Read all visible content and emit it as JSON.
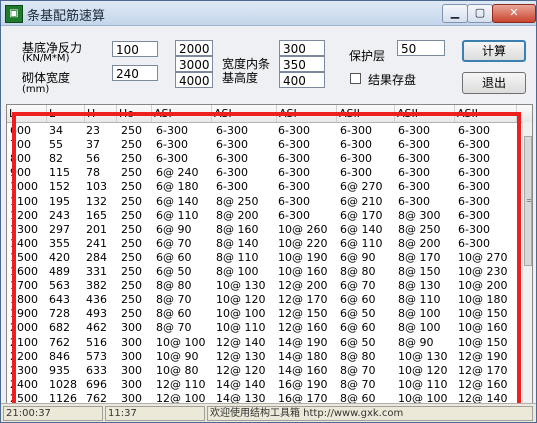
{
  "window": {
    "title": "条基配筋速算",
    "minimize": "0",
    "restore": "1",
    "close": "r"
  },
  "form": {
    "pressure_label": "基底净反力",
    "pressure_unit": "(KN/M*M)",
    "pressure_value": "100",
    "wall_width_label": "砌体宽度",
    "wall_width_unit": "(mm)",
    "wall_width_value": "240",
    "width_values": [
      "2000",
      "3000",
      "4000"
    ],
    "height_label_line1": "宽度内条",
    "height_label_line2": "基高度",
    "height_values": [
      "300",
      "350",
      "400"
    ],
    "cover_label": "保护层",
    "cover_value": "50",
    "save_label": "结果存盘",
    "save_checked": false,
    "calc_button": "计算",
    "exit_button": "退出"
  },
  "table": {
    "columns": [
      "L",
      "L",
      "H",
      "Ho",
      "ASI",
      "ASI",
      "ASI",
      "ASII",
      "ASII",
      "ASII"
    ],
    "rows": [
      [
        "600",
        "34",
        "23",
        "250",
        "6-300",
        "6-300",
        "6-300",
        "6-300",
        "6-300",
        "6-300"
      ],
      [
        "700",
        "55",
        "37",
        "250",
        "6-300",
        "6-300",
        "6-300",
        "6-300",
        "6-300",
        "6-300"
      ],
      [
        "800",
        "82",
        "56",
        "250",
        "6-300",
        "6-300",
        "6-300",
        "6-300",
        "6-300",
        "6-300"
      ],
      [
        "900",
        "115",
        "78",
        "250",
        "6@ 240",
        "6-300",
        "6-300",
        "6-300",
        "6-300",
        "6-300"
      ],
      [
        "1000",
        "152",
        "103",
        "250",
        "6@ 180",
        "6-300",
        "6-300",
        "6@ 270",
        "6-300",
        "6-300"
      ],
      [
        "1100",
        "195",
        "132",
        "250",
        "6@ 140",
        "8@ 250",
        "6-300",
        "6@ 210",
        "6-300",
        "6-300"
      ],
      [
        "1200",
        "243",
        "165",
        "250",
        "6@ 110",
        "8@ 200",
        "6-300",
        "6@ 170",
        "8@ 300",
        "6-300"
      ],
      [
        "1300",
        "297",
        "201",
        "250",
        "6@ 90",
        "8@ 160",
        "10@ 260",
        "6@ 140",
        "8@ 250",
        "6-300"
      ],
      [
        "1400",
        "355",
        "241",
        "250",
        "6@ 70",
        "8@ 140",
        "10@ 220",
        "6@ 110",
        "8@ 200",
        "6-300"
      ],
      [
        "1500",
        "420",
        "284",
        "250",
        "6@ 60",
        "8@ 110",
        "10@ 190",
        "6@ 90",
        "8@ 170",
        "10@ 270"
      ],
      [
        "1600",
        "489",
        "331",
        "250",
        "6@ 50",
        "8@ 100",
        "10@ 160",
        "8@ 80",
        "8@ 150",
        "10@ 230"
      ],
      [
        "1700",
        "563",
        "382",
        "250",
        "8@ 80",
        "10@ 130",
        "12@ 200",
        "6@ 70",
        "8@ 130",
        "10@ 200"
      ],
      [
        "1800",
        "643",
        "436",
        "250",
        "8@ 70",
        "10@ 120",
        "12@ 170",
        "6@ 60",
        "8@ 110",
        "10@ 180"
      ],
      [
        "1900",
        "728",
        "493",
        "250",
        "8@ 60",
        "10@ 100",
        "12@ 150",
        "6@ 50",
        "8@ 100",
        "10@ 150"
      ],
      [
        "2000",
        "682",
        "462",
        "300",
        "8@ 70",
        "10@ 110",
        "12@ 160",
        "6@ 60",
        "8@ 100",
        "10@ 160"
      ],
      [
        "2100",
        "762",
        "516",
        "300",
        "10@ 100",
        "12@ 140",
        "14@ 190",
        "6@ 50",
        "8@ 90",
        "10@ 150"
      ],
      [
        "2200",
        "846",
        "573",
        "300",
        "10@ 90",
        "12@ 130",
        "14@ 180",
        "8@ 80",
        "10@ 130",
        "12@ 190"
      ],
      [
        "2300",
        "935",
        "633",
        "300",
        "10@ 80",
        "12@ 120",
        "14@ 160",
        "8@ 70",
        "10@ 120",
        "12@ 170"
      ],
      [
        "2400",
        "1028",
        "696",
        "300",
        "12@ 110",
        "14@ 140",
        "16@ 190",
        "8@ 70",
        "10@ 110",
        "12@ 160"
      ],
      [
        "2500",
        "1126",
        "762",
        "300",
        "12@ 100",
        "14@ 130",
        "16@ 170",
        "8@ 60",
        "10@ 100",
        "12@ 140"
      ]
    ]
  },
  "status": [
    "21:00:37",
    "11:37",
    "欢迎使用结构工具箱  http://www.gxk.com"
  ]
}
